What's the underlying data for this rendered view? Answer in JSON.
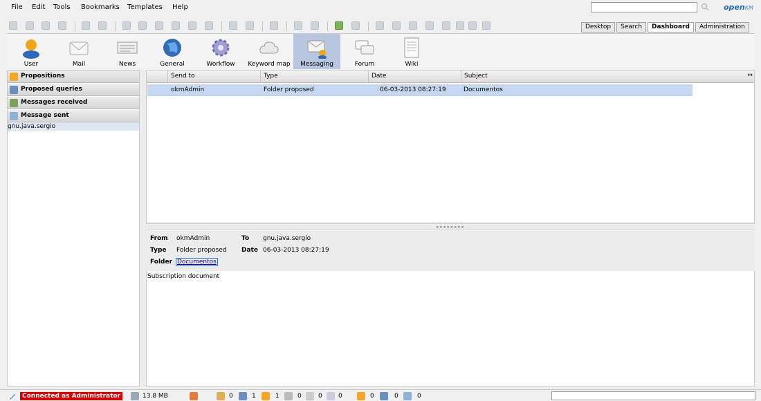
{
  "menu": [
    "File",
    "Edit",
    "Tools",
    "Bookmarks",
    "Templates",
    "Help"
  ],
  "search": {
    "value": ""
  },
  "logo": {
    "main": "open",
    "suffix": "KM"
  },
  "top_tabs": [
    {
      "label": "Desktop",
      "active": false
    },
    {
      "label": "Search",
      "active": false
    },
    {
      "label": "Dashboard",
      "active": true
    },
    {
      "label": "Administration",
      "active": false
    }
  ],
  "icon_bar": [
    {
      "label": "User",
      "icon": "user-icon"
    },
    {
      "label": "Mail",
      "icon": "mail-icon"
    },
    {
      "label": "News",
      "icon": "news-icon"
    },
    {
      "label": "General",
      "icon": "globe-icon"
    },
    {
      "label": "Workflow",
      "icon": "gear-icon"
    },
    {
      "label": "Keyword map",
      "icon": "cloud-icon"
    },
    {
      "label": "Messaging",
      "icon": "messaging-icon",
      "active": true
    },
    {
      "label": "Forum",
      "icon": "forum-icon"
    },
    {
      "label": "Wiki",
      "icon": "wiki-icon"
    }
  ],
  "left_panel": {
    "sections": [
      {
        "label": "Propositions",
        "icon": "propositions-icon",
        "color": "#f5a623"
      },
      {
        "label": "Proposed queries",
        "icon": "queries-icon",
        "color": "#6c8ebf"
      },
      {
        "label": "Messages received",
        "icon": "received-icon",
        "color": "#7aa35a"
      },
      {
        "label": "Message sent",
        "icon": "sent-icon",
        "color": "#8fb0d8"
      }
    ],
    "selected_item": "gnu.java.sergio"
  },
  "grid": {
    "columns": [
      "Send to",
      "Type",
      "Date",
      "Subject"
    ],
    "rows": [
      {
        "send_to": "okmAdmin",
        "type": "Folder proposed",
        "date": "06-03-2013 08:27:19",
        "subject": "Documentos"
      }
    ]
  },
  "detail": {
    "from_label": "From",
    "from": "okmAdmin",
    "to_label": "To",
    "to": "gnu.java.sergio",
    "type_label": "Type",
    "type": "Folder proposed",
    "date_label": "Date",
    "date": "06-03-2013 08:27:19",
    "folder_label": "Folder",
    "folder": "Documentos",
    "message": "Subscription document"
  },
  "status": {
    "connection": "Connected as Administrator",
    "memory": "13.8 MB",
    "counts": [
      "0",
      "1",
      "1",
      "0",
      "0",
      "0",
      "0",
      "0",
      "0"
    ]
  },
  "colors": {
    "accent": "#b8c6df",
    "selected_row": "#c6d7f1",
    "status_red": "#dd0000"
  }
}
